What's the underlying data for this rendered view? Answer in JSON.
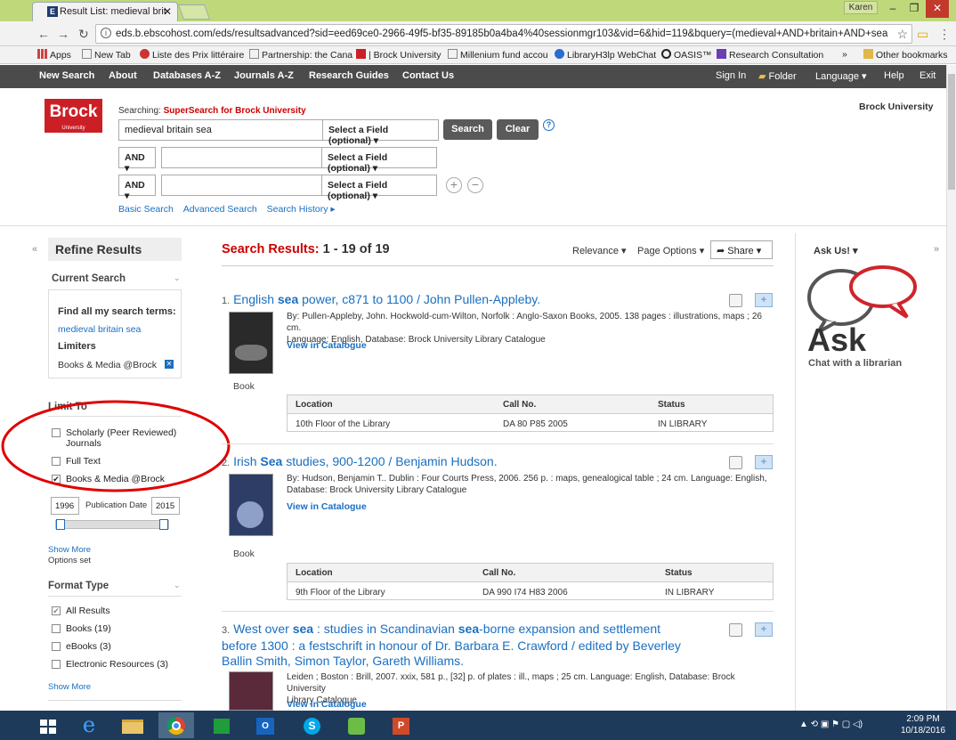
{
  "browser": {
    "tab_title": "Result List: medieval brit",
    "profile": "Karen",
    "url": "eds.b.ebscohost.com/eds/resultsadvanced?sid=eed69ce0-2966-49f5-bf35-89185b0a4ba4%40sessionmgr103&vid=6&hid=119&bquery=(medieval+AND+britain+AND+sea",
    "bookmarks": [
      "Apps",
      "New Tab",
      "Liste des Prix littéraire",
      "Partnership: the Cana",
      "| Brock University",
      "Millenium fund accou",
      "LibraryH3lp WebChat",
      "OASIS™",
      "Research Consultation",
      "»",
      "Other bookmarks"
    ]
  },
  "toolbar": {
    "left": [
      "New Search",
      "About",
      "Databases A-Z",
      "Journals A-Z",
      "Research Guides",
      "Contact Us"
    ],
    "right": [
      "Sign In",
      "Folder",
      "Language ▾",
      "Help",
      "Exit"
    ]
  },
  "header": {
    "logo": "Brock",
    "logo_sub": "University",
    "searching_label": "Searching:",
    "searching_target": "SuperSearch for Brock University",
    "query": "medieval britain sea",
    "field_select": "Select a Field (optional)",
    "op1": "AND",
    "op2": "AND",
    "search_btn": "Search",
    "clear_btn": "Clear",
    "links": [
      "Basic Search",
      "Advanced Search",
      "Search History ▸"
    ],
    "institution": "Brock University"
  },
  "sidebar": {
    "refine": "Refine Results",
    "current_search": "Current Search",
    "find_all": "Find all my search terms:",
    "find_all_value": "medieval britain sea",
    "limiters": "Limiters",
    "limiter_value": "Books & Media @Brock",
    "limit_to": "Limit To",
    "limit_options": [
      {
        "label": "Scholarly (Peer Reviewed)",
        "label2": "Journals",
        "checked": false
      },
      {
        "label": "Full Text",
        "checked": false
      },
      {
        "label": "Books & Media @Brock",
        "checked": true
      }
    ],
    "pub_from": "1996",
    "pub_label": "Publication Date",
    "pub_to": "2015",
    "show_more": "Show More",
    "options_set": "Options set",
    "format_type": "Format Type",
    "format_options": [
      {
        "label": "All Results",
        "checked": true
      },
      {
        "label": "Books (19)",
        "checked": false
      },
      {
        "label": "eBooks (3)",
        "checked": false
      },
      {
        "label": "Electronic Resources (3)",
        "checked": false
      }
    ],
    "show_more2": "Show More"
  },
  "results": {
    "heading": "Search Results:",
    "range": "1 - 19 of 19",
    "relevance": "Relevance ▾",
    "page_options": "Page Options ▾",
    "share": "Share ▾",
    "items": [
      {
        "num": "1.",
        "title_a": "English ",
        "title_b": "sea",
        "title_c": " power, c871 to 1100 / John Pullen-Appleby.",
        "meta1": "By: Pullen-Appleby, John. Hockwold-cum-Wilton, Norfolk : Anglo-Saxon Books, 2005. 138 pages : illustrations, maps ; 26 cm.",
        "meta2": "Language: English, Database: Brock University Library Catalogue",
        "view": "View in Catalogue",
        "type": "Book",
        "cols": [
          "Location",
          "Call No.",
          "Status"
        ],
        "row": [
          "10th Floor of the Library",
          "DA 80 P85 2005",
          "IN LIBRARY"
        ]
      },
      {
        "num": "2.",
        "title_a": "Irish ",
        "title_b": "Sea",
        "title_c": " studies, 900-1200 / Benjamin Hudson.",
        "meta1": "By: Hudson, Benjamin T.. Dublin : Four Courts Press, 2006. 256 p. : maps, genealogical table ; 24 cm. Language: English,",
        "meta2": "Database: Brock University Library Catalogue",
        "view": "View in Catalogue",
        "type": "Book",
        "cols": [
          "Location",
          "Call No.",
          "Status"
        ],
        "row": [
          "9th Floor of the Library",
          "DA 990 I74 H83 2006",
          "IN LIBRARY"
        ]
      },
      {
        "num": "3.",
        "title_line1_a": "West over ",
        "title_line1_b": "sea",
        "title_line1_c": " : studies in Scandinavian ",
        "title_line1_d": "sea",
        "title_line1_e": "-borne expansion and settlement",
        "title_line2": "before 1300 : a festschrift in honour of Dr. Barbara E. Crawford / edited by Beverley",
        "title_line3": "Ballin Smith, Simon Taylor, Gareth Williams.",
        "meta1": "Leiden ; Boston : Brill, 2007. xxix, 581 p., [32] p. of plates : ill., maps ; 25 cm. Language: English, Database: Brock University",
        "meta2": "Library Catalogue",
        "view": "View in Catalogue"
      }
    ]
  },
  "right": {
    "ask_us": "Ask Us! ▾",
    "ask_big": "Ask",
    "ask_sub": "Chat with a librarian"
  },
  "taskbar": {
    "time": "2:09 PM",
    "date": "10/18/2016"
  }
}
